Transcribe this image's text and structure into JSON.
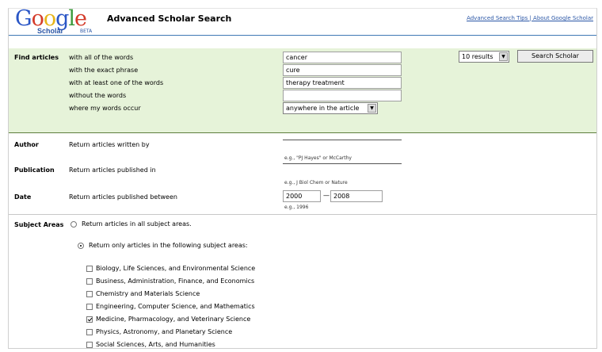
{
  "header": {
    "logo_text": "Google",
    "logo_sub": "Scholar",
    "logo_beta": "BETA",
    "title": "Advanced Scholar Search",
    "links": "Advanced Search Tips | About Google Scholar"
  },
  "find_articles": {
    "label": "Find articles",
    "rows": [
      {
        "label": "with all of the words",
        "value": "cancer"
      },
      {
        "label": "with the exact phrase",
        "value": "cure"
      },
      {
        "label": "with at least one of the words",
        "value": "therapy treatment"
      },
      {
        "label": "without the words",
        "value": ""
      },
      {
        "label": "where my words occur",
        "value": "anywhere in the article"
      }
    ],
    "results_select": "10 results",
    "search_button": "Search Scholar"
  },
  "author": {
    "label": "Author",
    "text": "Return articles written by",
    "value": "",
    "hint": "e.g., \"PJ Hayes\" or McCarthy"
  },
  "publication": {
    "label": "Publication",
    "text": "Return articles published in",
    "value": "",
    "hint": "e.g., J Biol Chem or Nature"
  },
  "date": {
    "label": "Date",
    "text": "Return articles published between",
    "from": "2000",
    "to": "2008",
    "hint": "e.g., 1996"
  },
  "subject_areas": {
    "label": "Subject Areas",
    "radio_all": "Return articles in all subject areas.",
    "radio_only": "Return only articles in the following subject areas:",
    "checkboxes": [
      {
        "label": "Biology, Life Sciences, and Environmental Science",
        "checked": false
      },
      {
        "label": "Business, Administration, Finance, and Economics",
        "checked": false
      },
      {
        "label": "Chemistry and Materials Science",
        "checked": false
      },
      {
        "label": "Engineering, Computer Science, and Mathematics",
        "checked": false
      },
      {
        "label": "Medicine, Pharmacology, and Veterinary Science",
        "checked": true
      },
      {
        "label": "Physics, Astronomy, and Planetary Science",
        "checked": false
      },
      {
        "label": "Social Sciences, Arts, and Humanities",
        "checked": false
      }
    ]
  }
}
